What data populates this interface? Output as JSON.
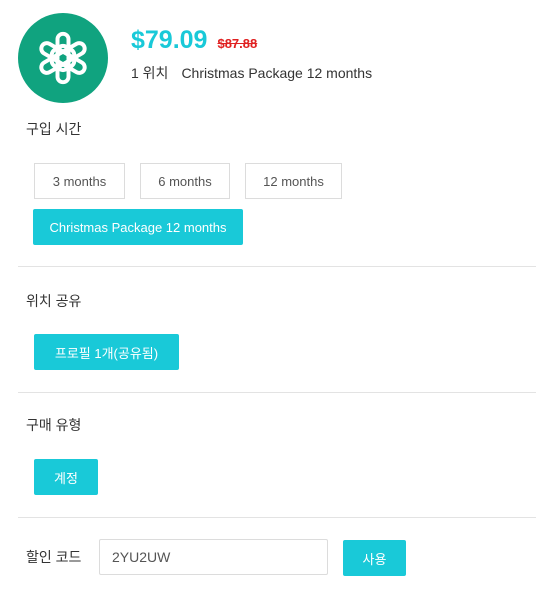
{
  "product": {
    "logo_icon": "openai-logo-icon",
    "brand_color": "#10a37f",
    "price": "$79.09",
    "original_price": "$87.88",
    "quantity_label": "1 위치",
    "package_name": "Christmas Package 12 months"
  },
  "accent_color": "#19c9d8",
  "duration": {
    "label": "구입 시간",
    "options": [
      "3 months",
      "6 months",
      "12 months",
      "Christmas Package 12 months"
    ],
    "selected": "Christmas Package 12 months"
  },
  "sharing": {
    "label": "위치 공유",
    "option": "프로필 1개(공유됨)"
  },
  "purchase_type": {
    "label": "구매 유형",
    "option": "계정"
  },
  "coupon": {
    "label": "할인 코드",
    "value": "2YU2UW",
    "apply_label": "사용"
  }
}
